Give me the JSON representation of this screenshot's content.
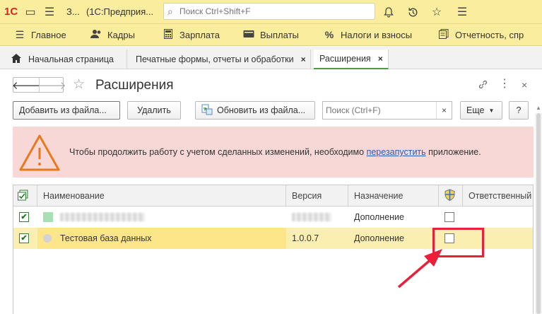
{
  "titlebar": {
    "logo": "1С",
    "title_short": "З...",
    "title_app": "(1С:Предприя...",
    "search_placeholder": "Поиск Ctrl+Shift+F",
    "icons": [
      "menu-icon",
      "bell-icon",
      "history-icon",
      "star-icon",
      "hamburger-icon"
    ]
  },
  "nav": {
    "items": [
      {
        "label": "Главное",
        "icon": "menu-icon"
      },
      {
        "label": "Кадры",
        "icon": "people-icon"
      },
      {
        "label": "Зарплата",
        "icon": "calculator-icon"
      },
      {
        "label": "Выплаты",
        "icon": "wallet-icon"
      },
      {
        "label": "Налоги и взносы",
        "icon": "percent-icon"
      },
      {
        "label": "Отчетность, спр",
        "icon": "reports-icon"
      }
    ]
  },
  "tabs": [
    {
      "label": "Начальная страница"
    },
    {
      "label": "Печатные формы, отчеты и обработки"
    },
    {
      "label": "Расширения"
    }
  ],
  "form": {
    "title": "Расширения",
    "toolbar": {
      "add_from_file": "Добавить из файла...",
      "delete": "Удалить",
      "update_from_file": "Обновить из файла...",
      "search_placeholder": "Поиск (Ctrl+F)",
      "clear": "×",
      "more": "Еще",
      "help": "?"
    },
    "warning": {
      "text_before": "Чтобы продолжить работу с учетом сделанных изменений, необходимо ",
      "link": "перезапустить",
      "text_after": " приложение."
    }
  },
  "table": {
    "columns": [
      "Наименование",
      "Версия",
      "Назначение",
      "Ответственный"
    ],
    "rows": [
      {
        "active": true,
        "name": "",
        "version": "",
        "purpose": "Дополнение",
        "safe_mode": false,
        "redacted": true
      },
      {
        "active": true,
        "name": "Тестовая база данных",
        "version": "1.0.0.7",
        "purpose": "Дополнение",
        "safe_mode": false,
        "redacted": false
      }
    ]
  },
  "colors": {
    "accent_yellow": "#fbed9e",
    "warning_bg": "#f8d7d7",
    "warning_icon": "#e87a1e",
    "annotation": "#e8203a",
    "active_tab": "#4a9a4a"
  }
}
